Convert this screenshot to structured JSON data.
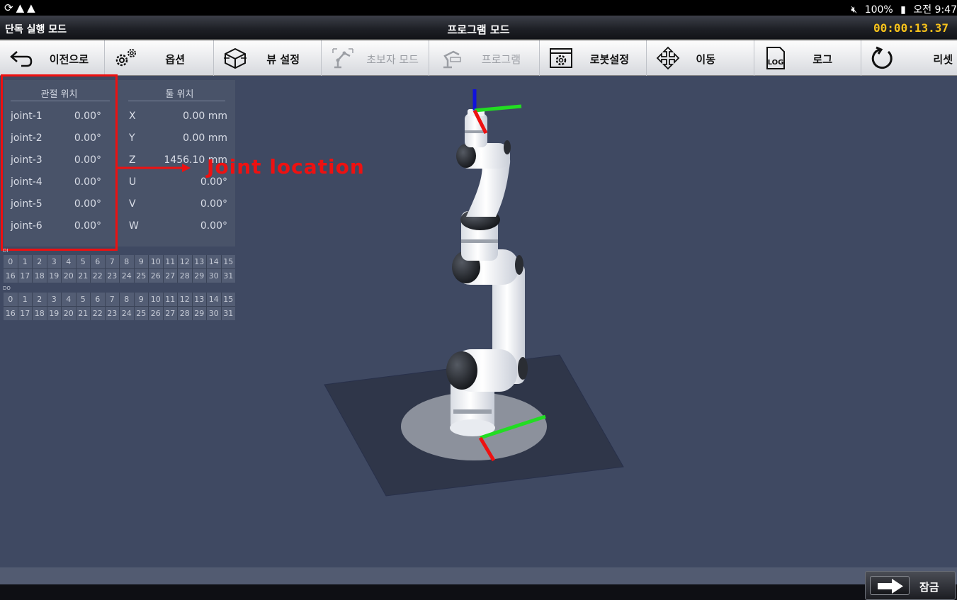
{
  "status_bar": {
    "left_icons": [
      "sync-icon",
      "warning-icon",
      "warning-icon"
    ],
    "battery": "100%",
    "time": "오전 9:47"
  },
  "title_bar": {
    "mode": "단독 실행 모드",
    "title": "프로그램 모드",
    "timer": "00:00:13.37"
  },
  "toolbar": {
    "back": "이전으로",
    "options": "옵션",
    "view_settings": "뷰 설정",
    "beginner_mode": "초보자 모드",
    "program": "프로그램",
    "robot_settings": "로봇설정",
    "move": "이동",
    "log": "로그",
    "reset": "리셋",
    "log_icon_text": "LOG"
  },
  "position_panel": {
    "joint_header": "관절 위치",
    "tool_header": "툴 위치",
    "joints": [
      {
        "name": "joint-1",
        "value": "0.00°"
      },
      {
        "name": "joint-2",
        "value": "0.00°"
      },
      {
        "name": "joint-3",
        "value": "0.00°"
      },
      {
        "name": "joint-4",
        "value": "0.00°"
      },
      {
        "name": "joint-5",
        "value": "0.00°"
      },
      {
        "name": "joint-6",
        "value": "0.00°"
      }
    ],
    "tool": [
      {
        "axis": "X",
        "value": "0.00 mm"
      },
      {
        "axis": "Y",
        "value": "0.00 mm"
      },
      {
        "axis": "Z",
        "value": "1456.10 mm"
      },
      {
        "axis": "U",
        "value": "0.00°"
      },
      {
        "axis": "V",
        "value": "0.00°"
      },
      {
        "axis": "W",
        "value": "0.00°"
      }
    ]
  },
  "annotation": {
    "label": "Joint location",
    "color": "#ee1111"
  },
  "io": {
    "input_tag": "DI",
    "output_tag": "DO",
    "channels": [
      "0",
      "1",
      "2",
      "3",
      "4",
      "5",
      "6",
      "7",
      "8",
      "9",
      "10",
      "11",
      "12",
      "13",
      "14",
      "15",
      "16",
      "17",
      "18",
      "19",
      "20",
      "21",
      "22",
      "23",
      "24",
      "25",
      "26",
      "27",
      "28",
      "29",
      "30",
      "31"
    ]
  },
  "footer": {
    "lock": "잠금"
  },
  "colors": {
    "background": "#3f4962",
    "timer": "#f7c21b",
    "axis_x": "#ee1111",
    "axis_y": "#22dd22",
    "axis_z": "#1111dd"
  }
}
